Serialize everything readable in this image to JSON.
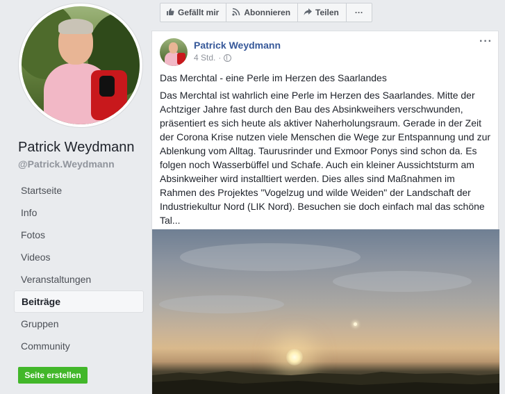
{
  "sidebar": {
    "page_name": "Patrick Weydmann",
    "page_handle": "@Patrick.Weydmann",
    "nav_items": [
      {
        "label": "Startseite"
      },
      {
        "label": "Info"
      },
      {
        "label": "Fotos"
      },
      {
        "label": "Videos"
      },
      {
        "label": "Veranstaltungen"
      },
      {
        "label": "Beiträge",
        "active": true
      },
      {
        "label": "Gruppen"
      },
      {
        "label": "Community"
      }
    ],
    "create_button": "Seite erstellen"
  },
  "actionbar": {
    "like": {
      "label": "Gefällt mir",
      "icon": "thumbs-up-icon"
    },
    "follow": {
      "label": "Abonnieren",
      "icon": "rss-icon"
    },
    "share": {
      "label": "Teilen",
      "icon": "share-arrow-icon"
    },
    "more": {
      "label": "···",
      "icon": "more-icon"
    }
  },
  "post": {
    "author": "Patrick Weydmann",
    "time": "4 Std.",
    "separator": "·",
    "privacy_icon": "globe-icon",
    "more_label": "···",
    "title": "Das Merchtal - eine Perle im Herzen des Saarlandes",
    "text": "Das Merchtal ist wahrlich eine Perle im Herzen des Saarlandes. Mitte der Achtziger Jahre fast durch den Bau des Absinkweihers verschwunden, präsentiert es sich heute als aktiver Naherholungsraum. Gerade in der Zeit der Corona Krise nutzen viele Menschen die Wege zur Entspannung und zur Ablenkung vom Alltag. Taurusrinder und Exmoor Ponys sind schon da. Es folgen noch Wasserbüffel und Schafe. Auch ein kleiner Aussichtsturm am Absinkweiher wird installtiert werden. Dies alles sind Maßnahmen im Rahmen des Projektes \"Vogelzug und wilde Weiden\" der Landschaft der Industriekultur Nord (LIK Nord). Besuchen sie doch einfach mal das schöne Tal...",
    "image": "sunset-landscape-photo"
  },
  "colors": {
    "page_bg": "#e9ebee",
    "link_blue": "#365899",
    "create_green": "#42b72a"
  }
}
